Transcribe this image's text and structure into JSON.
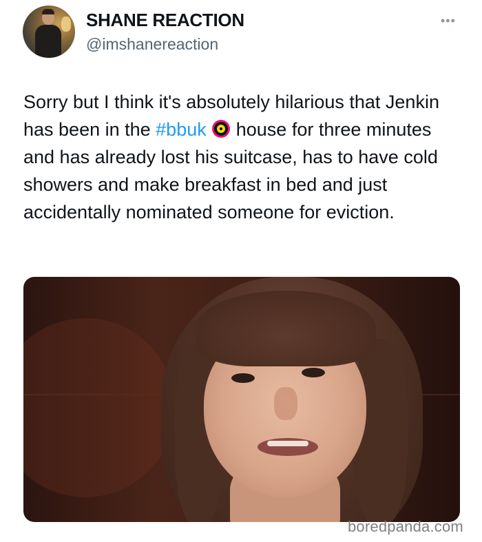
{
  "header": {
    "display_name": "SHANE REACTION",
    "handle": "@imshanereaction",
    "more_label": "•••"
  },
  "tweet": {
    "text_before": "Sorry but I think it's absolutely hilarious that Jenkin has been in the ",
    "hashtag": "#bbuk",
    "hashtag_icon": "big-brother-eye-icon",
    "text_after": " house for three minutes and has already lost his suitcase, has to have cold showers and make breakfast in bed and just accidentally nominated someone for eviction."
  },
  "media": {
    "content": "photo"
  },
  "watermark": "boredpanda.com",
  "colors": {
    "hashtag": "#1d9bf0",
    "handle": "#536471",
    "text": "#0f1419"
  }
}
